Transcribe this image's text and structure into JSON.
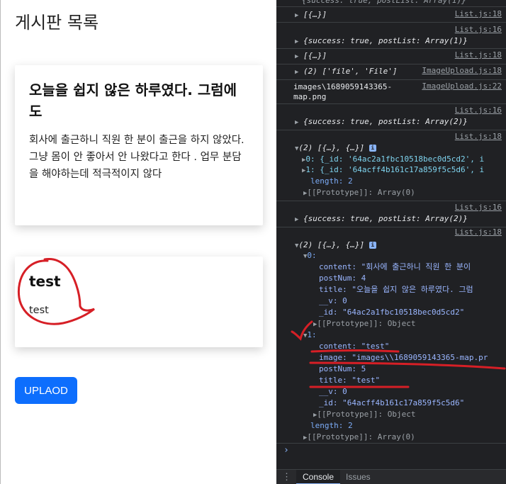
{
  "app": {
    "title": "게시판 목록",
    "posts": [
      {
        "title": "오늘을 쉽지 않은 하루였다. 그럼에도",
        "content": "회사에 출근하니 직원 한 분이 출근을 하지 않았다. 그냥 몸이 안 좋아서 안 나왔다고 한다 . 업무 분담을 해야하는데 적극적이지 않다"
      },
      {
        "title": "test",
        "content": "test"
      }
    ],
    "upload_label": "UPLAOD"
  },
  "console": {
    "top_partial": "{success: true, postList: Array(1)}",
    "lines": {
      "l1": "[{…}]",
      "l1_src": "List.js:18",
      "l2": "{success: true, postList: Array(1)}",
      "l2_src": "List.js:16",
      "l3": "[{…}]",
      "l3_src": "List.js:18",
      "l4_a": "(2) ['file', 'File']",
      "l4_src": "ImageUpload.js:18",
      "l5_a": "images\\1689059143365-",
      "l5_b": "map.png",
      "l5_src": "ImageUpload.js:22",
      "l6": "{success: true, postList: Array(2)}",
      "l6_src": "List.js:16",
      "l7_src": "List.js:18",
      "l7_head": "(2) [{…}, {…}]",
      "l7_item0": "0: {_id: '64ac2a1fbc10518bec0d5cd2', i",
      "l7_item1": "1: {_id: '64acff4b161c17a859f5c5d6', i",
      "l7_length": "length: 2",
      "l7_proto": "[[Prototype]]: Array(0)",
      "l8": "{success: true, postList: Array(2)}",
      "l8_src": "List.js:16",
      "l9_src": "List.js:18",
      "l9_head": "(2) [{…}, {…}]",
      "e0": "0:",
      "e0_content": "content: \"회사에 출근하니 직원 한 분이",
      "e0_postnum": "postNum: 4",
      "e0_title": "title: \"오늘을 쉽지 않은 하루였다. 그럼",
      "e0_v": "__v: 0",
      "e0_id": "_id: \"64ac2a1fbc10518bec0d5cd2\"",
      "e0_proto": "[[Prototype]]: Object",
      "e1": "1:",
      "e1_content": "content: \"test\"",
      "e1_image": "image: \"images\\\\1689059143365-map.pr",
      "e1_postnum": "postNum: 5",
      "e1_title": "title: \"test\"",
      "e1_v": "__v: 0",
      "e1_id": "_id: \"64acff4b161c17a859f5c5d6\"",
      "e1_proto": "[[Prototype]]: Object",
      "l9_length": "length: 2",
      "l9_proto": "[[Prototype]]: Array(0)"
    },
    "prompt": "›"
  },
  "tabs": {
    "console": "Console",
    "issues": "Issues",
    "more": "⋮"
  },
  "colors": {
    "accent": "#0d6efd",
    "devtools_bg": "#202124",
    "annotation": "#d61f26"
  }
}
